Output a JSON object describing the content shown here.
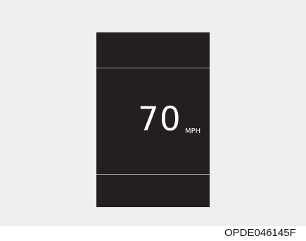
{
  "cluster_display": {
    "speed_value": "70",
    "speed_unit": "MPH"
  },
  "image_code": "OPDE046145F",
  "colors": {
    "background_panel": "#efefef",
    "display_background": "#231f20",
    "divider": "#9a9a9a",
    "text_primary": "#ffffff"
  }
}
